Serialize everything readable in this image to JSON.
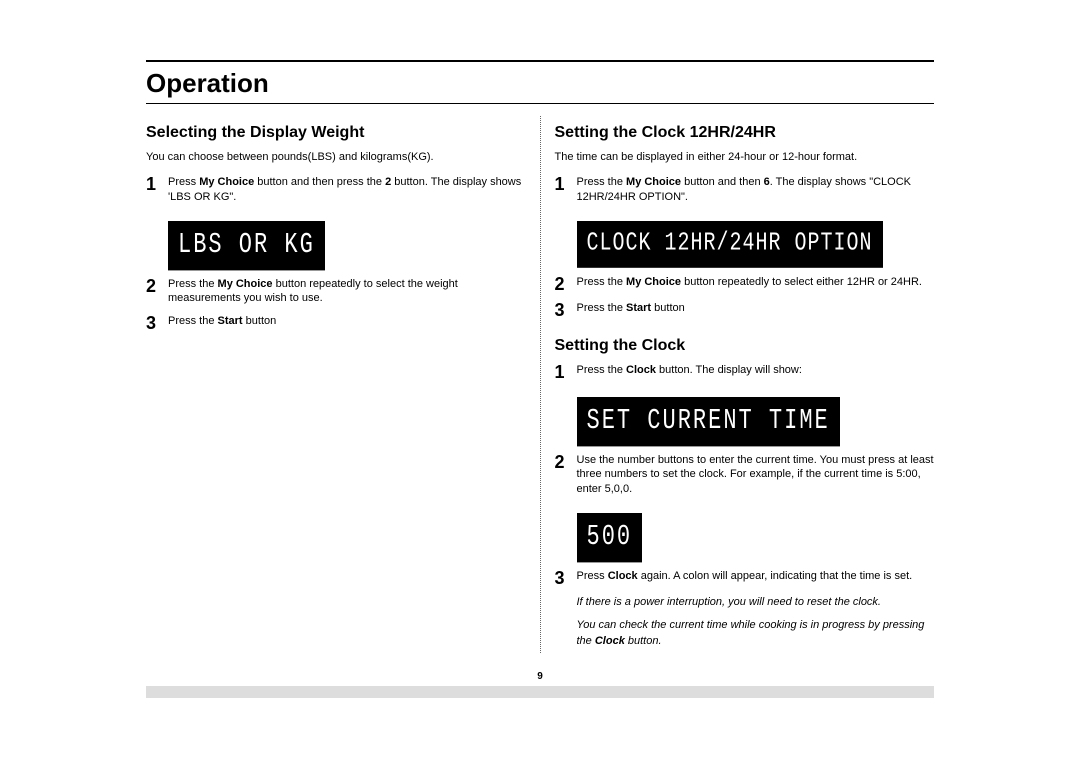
{
  "title": "Operation",
  "pageNumber": "9",
  "left": {
    "heading": "Selecting the Display Weight",
    "intro": "You can choose between pounds(LBS) and kilograms(KG).",
    "step1_a": "Press ",
    "step1_b": "My Choice",
    "step1_c": " button and then press the ",
    "step1_d": "2",
    "step1_e": " button. The display shows 'LBS OR KG\".",
    "lcd1": "LBS OR KG",
    "step2_a": "Press the ",
    "step2_b": "My Choice",
    "step2_c": " button repeatedly to select the weight measurements you wish to use.",
    "step3_a": "Press the ",
    "step3_b": "Start",
    "step3_c": " button"
  },
  "right": {
    "headingA": "Setting the Clock 12HR/24HR",
    "introA": "The time can be displayed in either 24-hour or 12-hour format.",
    "a1_a": "Press the ",
    "a1_b": "My Choice",
    "a1_c": " button and then ",
    "a1_d": "6",
    "a1_e": ". The display shows \"CLOCK 12HR/24HR OPTION\".",
    "lcdA": "CLOCK 12HR/24HR OPTION",
    "a2_a": "Press the ",
    "a2_b": "My Choice",
    "a2_c": " button repeatedly to select either 12HR or 24HR.",
    "a3_a": "Press the ",
    "a3_b": "Start",
    "a3_c": " button",
    "headingB": "Setting the Clock",
    "b1_a": "Press the ",
    "b1_b": "Clock",
    "b1_c": " button. The display will show:",
    "lcdB1": "SET CURRENT TIME",
    "b2": "Use the number buttons to enter the current time. You must press at least three numbers to set the clock. For example, if the current time is 5:00, enter 5,0,0.",
    "lcdB2": "500",
    "b3_a": "Press ",
    "b3_b": "Clock",
    "b3_c": " again. A colon will appear, indicating that the time is set.",
    "note1": "If there is a power interruption, you will need to reset the clock.",
    "note2_a": "You can check the current time while cooking is in progress by pressing the ",
    "note2_b": "Clock",
    "note2_c": " button."
  }
}
